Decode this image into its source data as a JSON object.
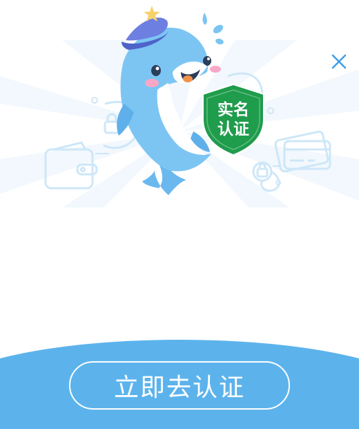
{
  "badge": {
    "line1": "实名",
    "line2": "认证"
  },
  "cta": {
    "label": "立即去认证"
  },
  "colors": {
    "accent": "#5cb3ec",
    "badge_green": "#1f9c4c",
    "hat_purple": "#6d7fe0",
    "dolphin_blue": "#79c3f2",
    "close_blue": "#3d9ee8"
  },
  "icons": {
    "close": "close-icon",
    "mascot": "dolphin-mascot-icon",
    "wallet": "wallet-icon",
    "card": "bank-card-icon",
    "lock": "lock-icon",
    "shield": "shield-icon"
  }
}
